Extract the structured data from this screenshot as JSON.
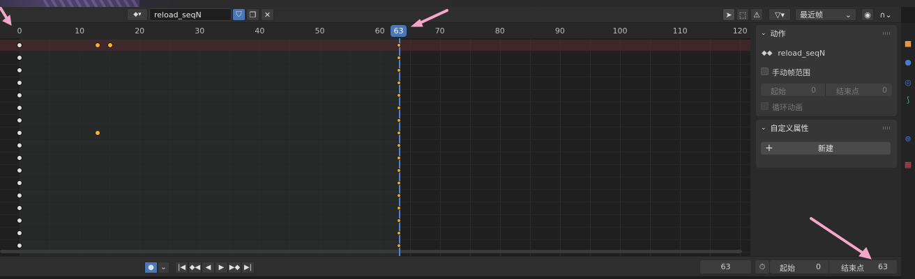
{
  "header": {
    "action_name": "reload_seqN",
    "interp_mode": "最近帧"
  },
  "ruler": {
    "ticks": [
      "0",
      "10",
      "20",
      "30",
      "40",
      "50",
      "60",
      "70",
      "80",
      "90",
      "100",
      "110",
      "120"
    ],
    "current_frame": "63"
  },
  "sidebar": {
    "action_panel": {
      "title": "动作",
      "action_name": "reload_seqN",
      "manual_range_label": "手动帧范围",
      "start_label": "起始",
      "start_value": "0",
      "end_label": "结束点",
      "end_value": "0",
      "cyclic_label": "循环动画"
    },
    "custom_props_panel": {
      "title": "自定义属性",
      "new_button": "新建"
    }
  },
  "playback": {
    "current_frame": "63",
    "start_label": "起始",
    "start_value": "0",
    "end_label": "结束点",
    "end_value": "63"
  },
  "colors": {
    "accent": "#4a78b6",
    "keyframe_selected": "#f3b235",
    "keyframe_unselected": "#dedede",
    "annotation_arrow": "#f4a6c8"
  }
}
